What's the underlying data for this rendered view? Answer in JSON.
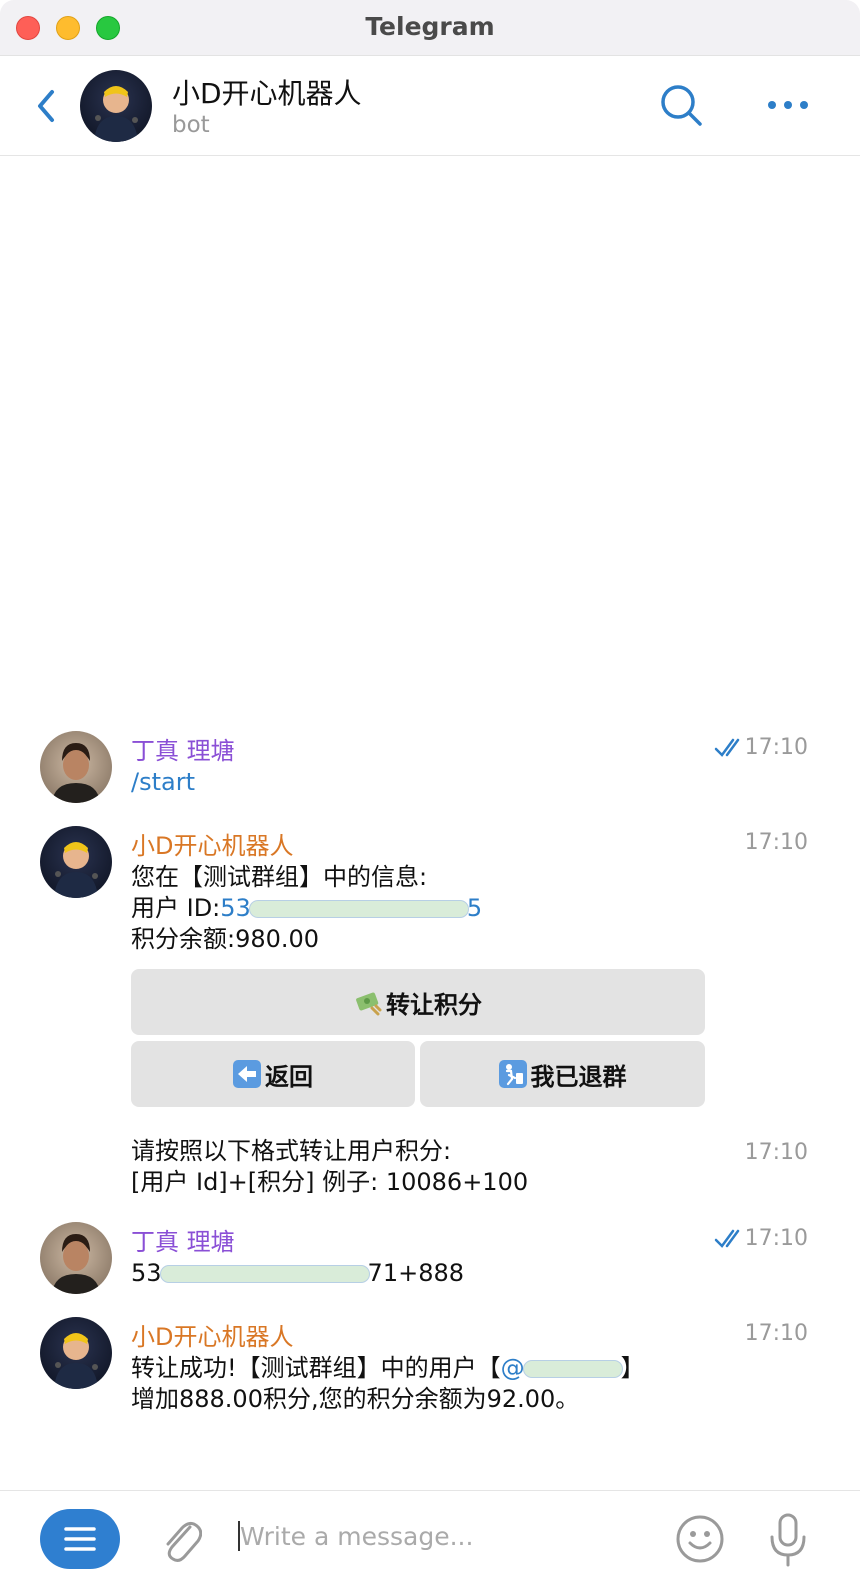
{
  "window": {
    "title": "Telegram"
  },
  "header": {
    "name": "小D开心机器人",
    "status": "bot"
  },
  "messages": [
    {
      "sender": "丁真 理塘",
      "text": "/start",
      "time": "17:10"
    },
    {
      "sender": "小D开心机器人",
      "line1": "您在【测试群组】中的信息:",
      "line2_prefix": "用户 ID:",
      "line2_id_start": "53",
      "line2_id_end": "5",
      "line3": "积分余额:980.00",
      "time": "17:10",
      "buttons": {
        "transfer": "转让积分",
        "back": "返回",
        "left": "我已退群"
      }
    },
    {
      "line1": "请按照以下格式转让用户积分:",
      "line2": "[用户 Id]+[积分] 例子: 10086+100",
      "time": "17:10"
    },
    {
      "sender": "丁真 理塘",
      "text_start": "53",
      "text_end": "71+888",
      "time": "17:10"
    },
    {
      "sender": "小D开心机器人",
      "line1_prefix": "转让成功!【测试群组】中的用户【",
      "line1_mention": "@",
      "line1_suffix": "】",
      "line2": "增加888.00积分,您的积分余额为92.00。",
      "time": "17:10"
    }
  ],
  "composer": {
    "placeholder": "Write a message..."
  },
  "icons": {
    "back": "chevron-left-icon",
    "search": "search-icon",
    "more": "more-icon",
    "menu": "menu-icon",
    "attach": "paperclip-icon",
    "emoji": "emoji-icon",
    "mic": "microphone-icon",
    "read": "double-check-icon",
    "money": "money-icon",
    "back_arrow": "left-arrow-icon",
    "trash": "trash-person-icon"
  },
  "colors": {
    "accent": "#2d7ec8",
    "user_name": "#8a4fd6",
    "bot_name": "#d97725",
    "menu_button": "#2f7fd0"
  }
}
